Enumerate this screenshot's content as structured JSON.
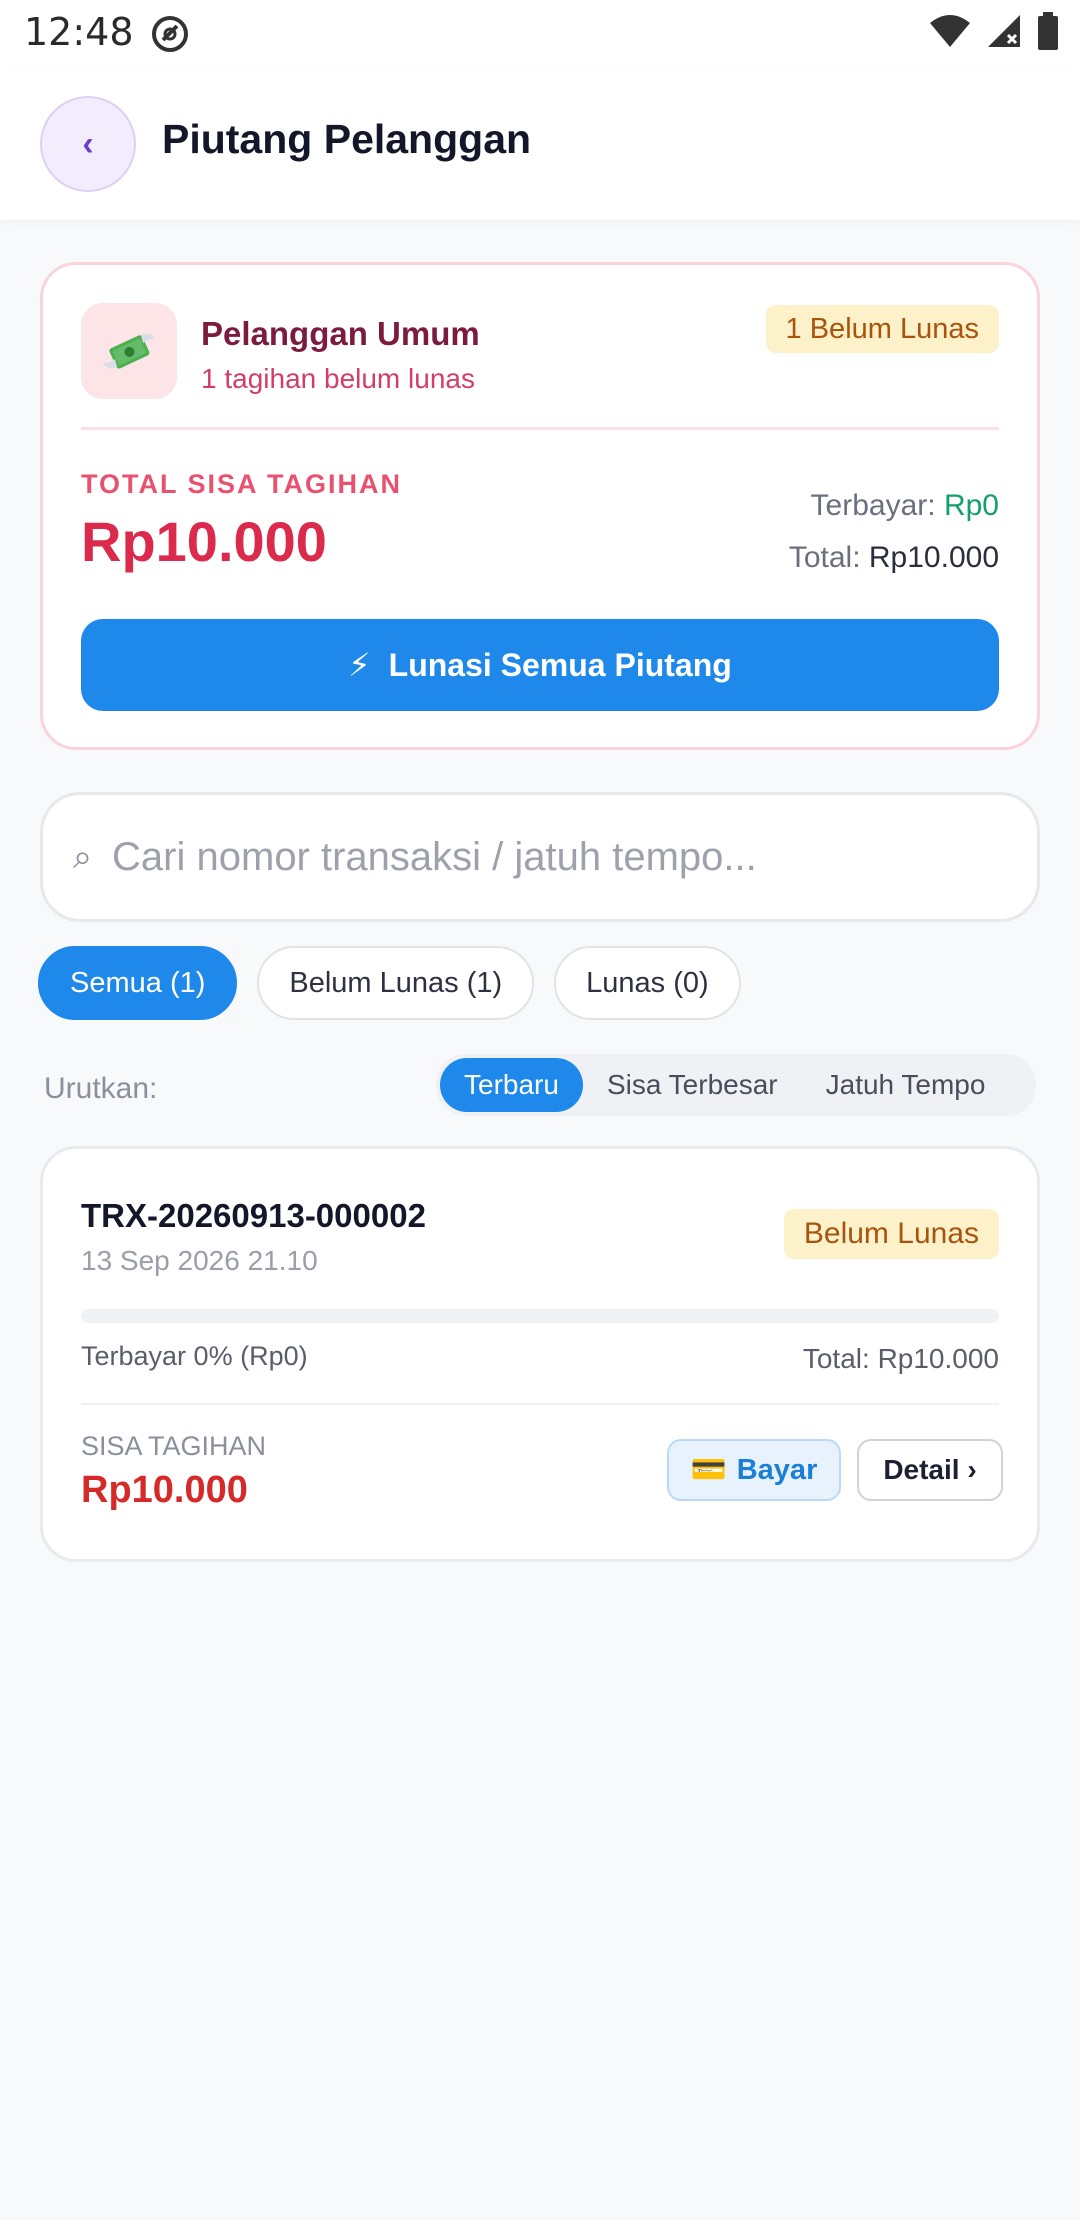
{
  "status_bar": {
    "time": "12:48"
  },
  "header": {
    "back_label": "‹",
    "title": "Piutang Pelanggan"
  },
  "summary": {
    "customer_name": "Pelanggan Umum",
    "customer_subtitle": "1 tagihan belum lunas",
    "status_badge": "1 Belum Lunas",
    "total_label": "TOTAL SISA TAGIHAN",
    "total_amount": "Rp10.000",
    "paid_label": "Terbayar:",
    "paid_value": "Rp0",
    "grand_total_label": "Total:",
    "grand_total_value": "Rp10.000",
    "pay_all_icon": "⚡",
    "pay_all_label": "Lunasi Semua Piutang"
  },
  "search": {
    "placeholder": "Cari nomor transaksi / jatuh tempo...",
    "value": ""
  },
  "filters": [
    {
      "label": "Semua (1)",
      "active": true
    },
    {
      "label": "Belum Lunas (1)",
      "active": false
    },
    {
      "label": "Lunas (0)",
      "active": false
    }
  ],
  "sort": {
    "label": "Urutkan:",
    "options": [
      {
        "label": "Terbaru",
        "active": true
      },
      {
        "label": "Sisa Terbesar",
        "active": false
      },
      {
        "label": "Jatuh Tempo",
        "active": false
      }
    ]
  },
  "transactions": [
    {
      "id": "TRX-20260913-000002",
      "date": "13 Sep 2026 21.10",
      "status": "Belum Lunas",
      "progress_fraction": 0,
      "paid_text": "Terbayar 0% (Rp0)",
      "total_text": "Total: Rp10.000",
      "remaining_label": "SISA TAGIHAN",
      "remaining_amount": "Rp10.000",
      "pay_icon": "💳",
      "pay_label": "Bayar",
      "detail_label": "Detail ›"
    }
  ],
  "colors": {
    "primary": "#1e88eb",
    "danger": "#dc2a4c",
    "success": "#14a06c",
    "warning_bg": "#fdf1c9",
    "warning_text": "#a8540c"
  },
  "icons": {
    "back": "chevron-left-icon",
    "customer": "money-wings-icon",
    "search": "search-icon",
    "pay_all": "lightning-icon",
    "pay": "credit-card-icon"
  }
}
